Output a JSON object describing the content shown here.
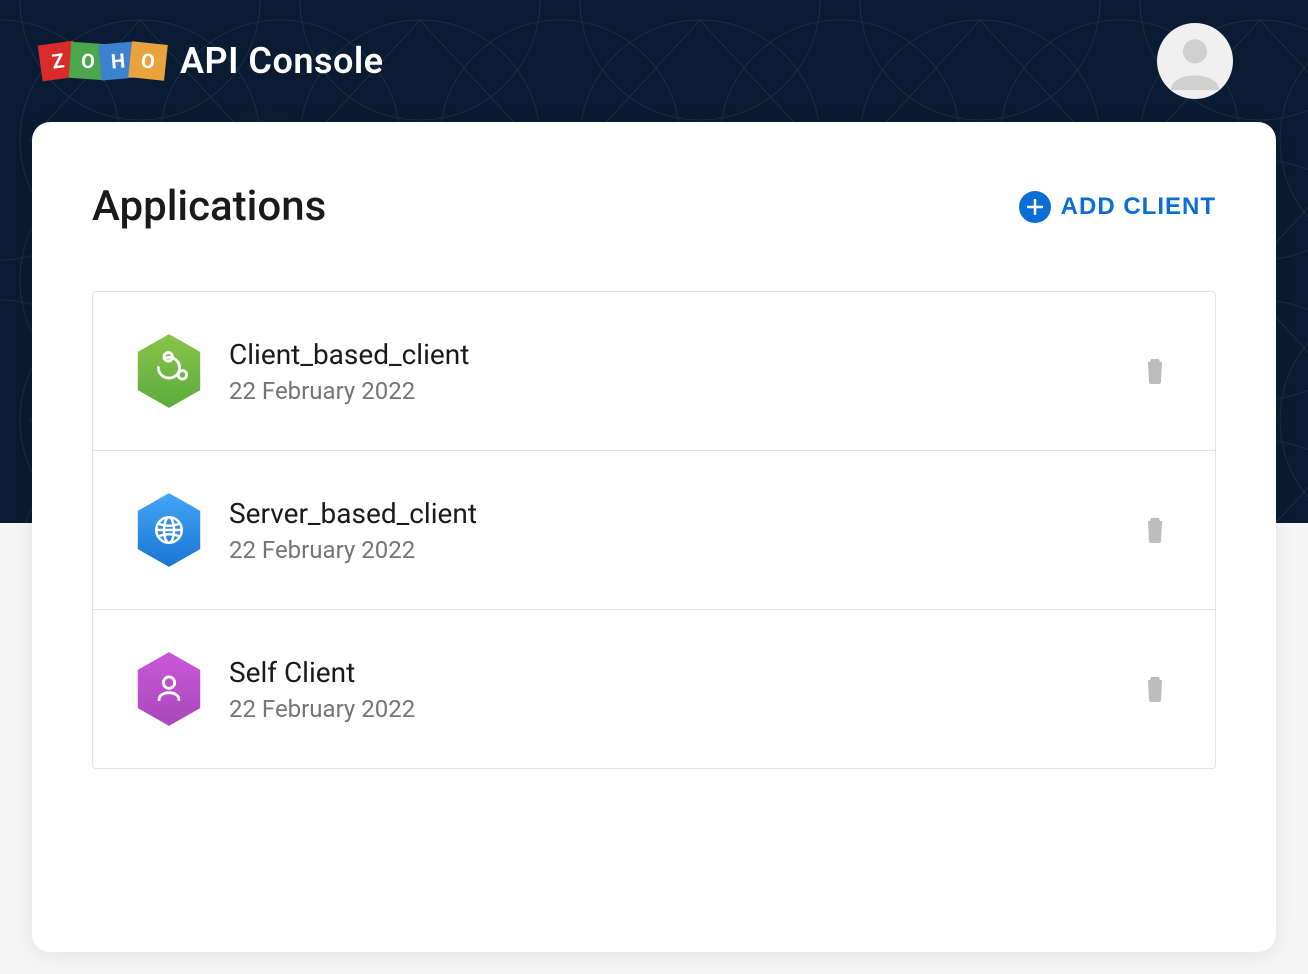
{
  "header": {
    "brand": "ZOHO",
    "title": "API Console"
  },
  "page": {
    "title": "Applications",
    "add_button": "ADD CLIENT"
  },
  "applications": [
    {
      "name": "Client_based_client",
      "date": "22 February 2022",
      "icon": "puzzle",
      "color_start": "#8bc34a",
      "color_end": "#5aad3e"
    },
    {
      "name": "Server_based_client",
      "date": "22 February 2022",
      "icon": "globe",
      "color_start": "#42a5f5",
      "color_end": "#1976d2"
    },
    {
      "name": "Self Client",
      "date": "22 February 2022",
      "icon": "person",
      "color_start": "#c858d8",
      "color_end": "#ab47bc"
    }
  ]
}
